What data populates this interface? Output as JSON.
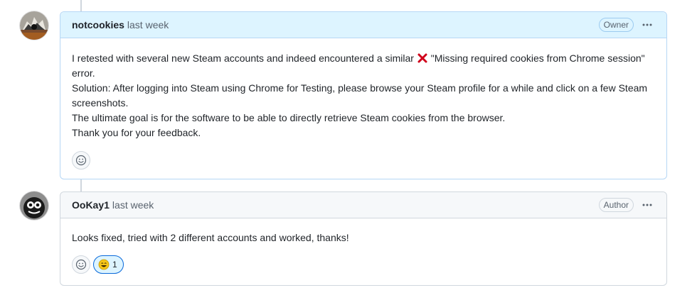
{
  "comments": [
    {
      "author": "notcookies",
      "time": "last week",
      "role": "Owner",
      "body": [
        {
          "pre": "I retested with several new Steam accounts and indeed encountered a similar ",
          "icon": "cross-mark-icon",
          "post": " \"Missing required cookies from Chrome session\" error."
        },
        {
          "text": "Solution: After logging into Steam using Chrome for Testing, please browse your Steam profile for a while and click on a few Steam screenshots."
        },
        {
          "text": "The ultimate goal is for the software to be able to directly retrieve Steam cookies from the browser."
        },
        {
          "text": "Thank you for your feedback."
        }
      ]
    },
    {
      "author": "OoKay1",
      "time": "last week",
      "role": "Author",
      "body": [
        {
          "text": "Looks fixed, tried with 2 different accounts and worked, thanks!"
        }
      ],
      "reactions": [
        {
          "emoji": "laugh",
          "count": "1"
        }
      ]
    }
  ],
  "colors": {
    "owner_header_bg": "#ddf4ff",
    "owner_border": "#b6d7f5",
    "reaction_accent": "#0969da",
    "cross_mark": "#d0021b"
  }
}
